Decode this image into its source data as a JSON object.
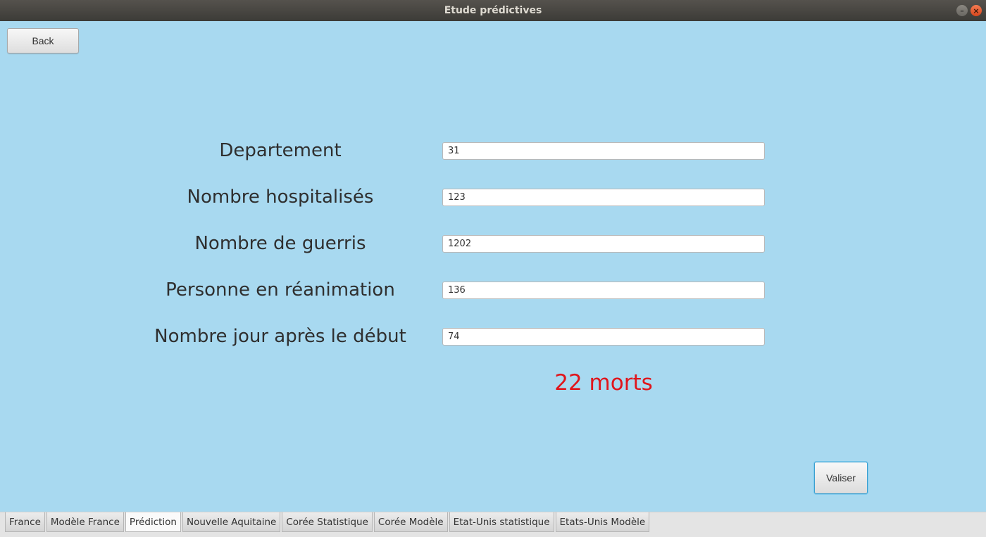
{
  "window": {
    "title": "Etude prédictives",
    "minimize_glyph": "–",
    "close_glyph": "×"
  },
  "toolbar": {
    "back_label": "Back"
  },
  "form": {
    "rows": [
      {
        "label": "Departement",
        "value": "31"
      },
      {
        "label": "Nombre hospitalisés",
        "value": "123"
      },
      {
        "label": "Nombre de guerris",
        "value": "1202"
      },
      {
        "label": "Personne en réanimation",
        "value": "136"
      },
      {
        "label": "Nombre jour après le début",
        "value": "74"
      }
    ],
    "result": "22 morts",
    "submit_label": "Valiser"
  },
  "tabs": [
    {
      "label": "France",
      "active": false
    },
    {
      "label": "Modèle France",
      "active": false
    },
    {
      "label": "Prédiction",
      "active": true
    },
    {
      "label": "Nouvelle Aquitaine",
      "active": false
    },
    {
      "label": "Corée Statistique",
      "active": false
    },
    {
      "label": "Corée Modèle",
      "active": false
    },
    {
      "label": "Etat-Unis statistique",
      "active": false
    },
    {
      "label": "Etats-Unis Modèle",
      "active": false
    }
  ],
  "colors": {
    "background": "#a8d9f0",
    "result_text": "#e0151b",
    "titlebar": "#3c3b37",
    "focus_border": "#3a9fd0"
  }
}
